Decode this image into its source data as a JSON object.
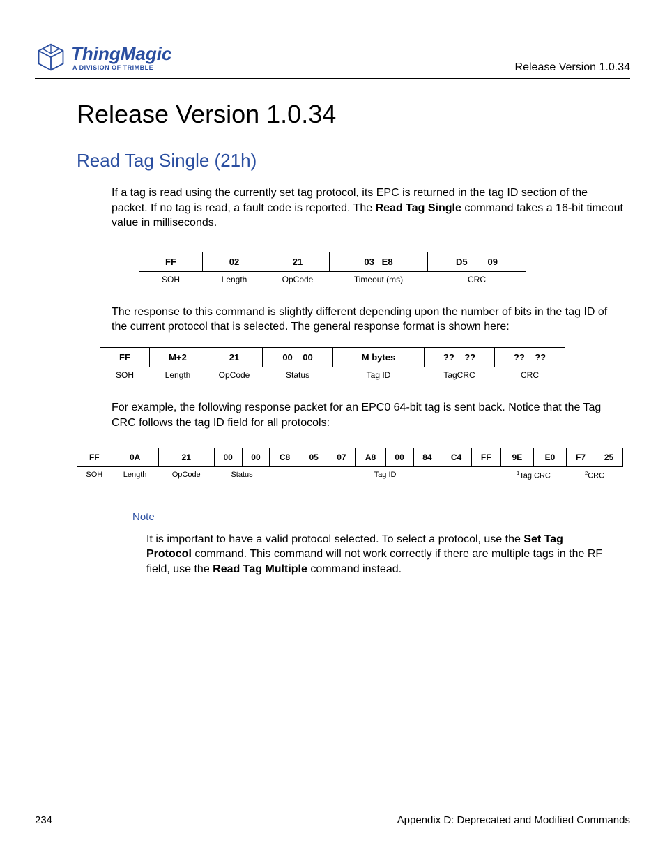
{
  "header": {
    "logo_main": "ThingMagic",
    "logo_sub": "A DIVISION OF TRIMBLE",
    "version_text": "Release Version 1.0.34"
  },
  "title": "Release Version 1.0.34",
  "section": "Read Tag Single (21h)",
  "paragraphs": {
    "p1a": "If a tag is read using the currently set tag protocol, its EPC is returned in the tag ID section of the packet. If no tag is read, a fault code is reported. The ",
    "p1b": "Read Tag Single",
    "p1c": " command takes a 16-bit timeout value in milliseconds.",
    "p2": "The response to this command is slightly different depending upon the number of bits in the tag ID of the current protocol that is selected. The general response format is shown here:",
    "p3": "For example, the following response packet for an EPC0 64-bit tag is sent back. Notice that the Tag CRC follows the tag ID field for all protocols:"
  },
  "table1": {
    "row": [
      "FF",
      "02",
      "21",
      "03   E8",
      "D5        09"
    ],
    "labels": [
      "SOH",
      "Length",
      "OpCode",
      "Timeout (ms)",
      "CRC"
    ]
  },
  "table2": {
    "row": [
      "FF",
      "M+2",
      "21",
      "00    00",
      "M bytes",
      "??    ??",
      "??    ??"
    ],
    "labels": [
      "SOH",
      "Length",
      "OpCode",
      "Status",
      "Tag ID",
      "TagCRC",
      "CRC"
    ]
  },
  "table3": {
    "row": [
      "FF",
      "0A",
      "21",
      "00",
      "00",
      "C8",
      "05",
      "07",
      "A8",
      "00",
      "84",
      "C4",
      "FF",
      "9E",
      "E0",
      "F7",
      "25"
    ],
    "labels": [
      "SOH",
      "Length",
      "OpCode",
      "Status_span",
      "Tag ID_span",
      "Tag CRC_span",
      "CRC_span"
    ],
    "l_soh": "SOH",
    "l_len": "Length",
    "l_op": "OpCode",
    "l_status": "Status",
    "l_tagid": "Tag ID",
    "l_tagcrc_sup": "1",
    "l_tagcrc": "Tag CRC",
    "l_crc_sup": "2",
    "l_crc": "CRC"
  },
  "note": {
    "heading": "Note",
    "t1": "It is important to have a valid protocol selected. To select a protocol, use the ",
    "t2": "Set Tag Protocol",
    "t3": " command. This command will not work correctly if there are multiple tags in the RF field, use the ",
    "t4": "Read Tag Multiple",
    "t5": " command instead."
  },
  "footer": {
    "page": "234",
    "appendix": "Appendix D: Deprecated and Modified Commands"
  }
}
